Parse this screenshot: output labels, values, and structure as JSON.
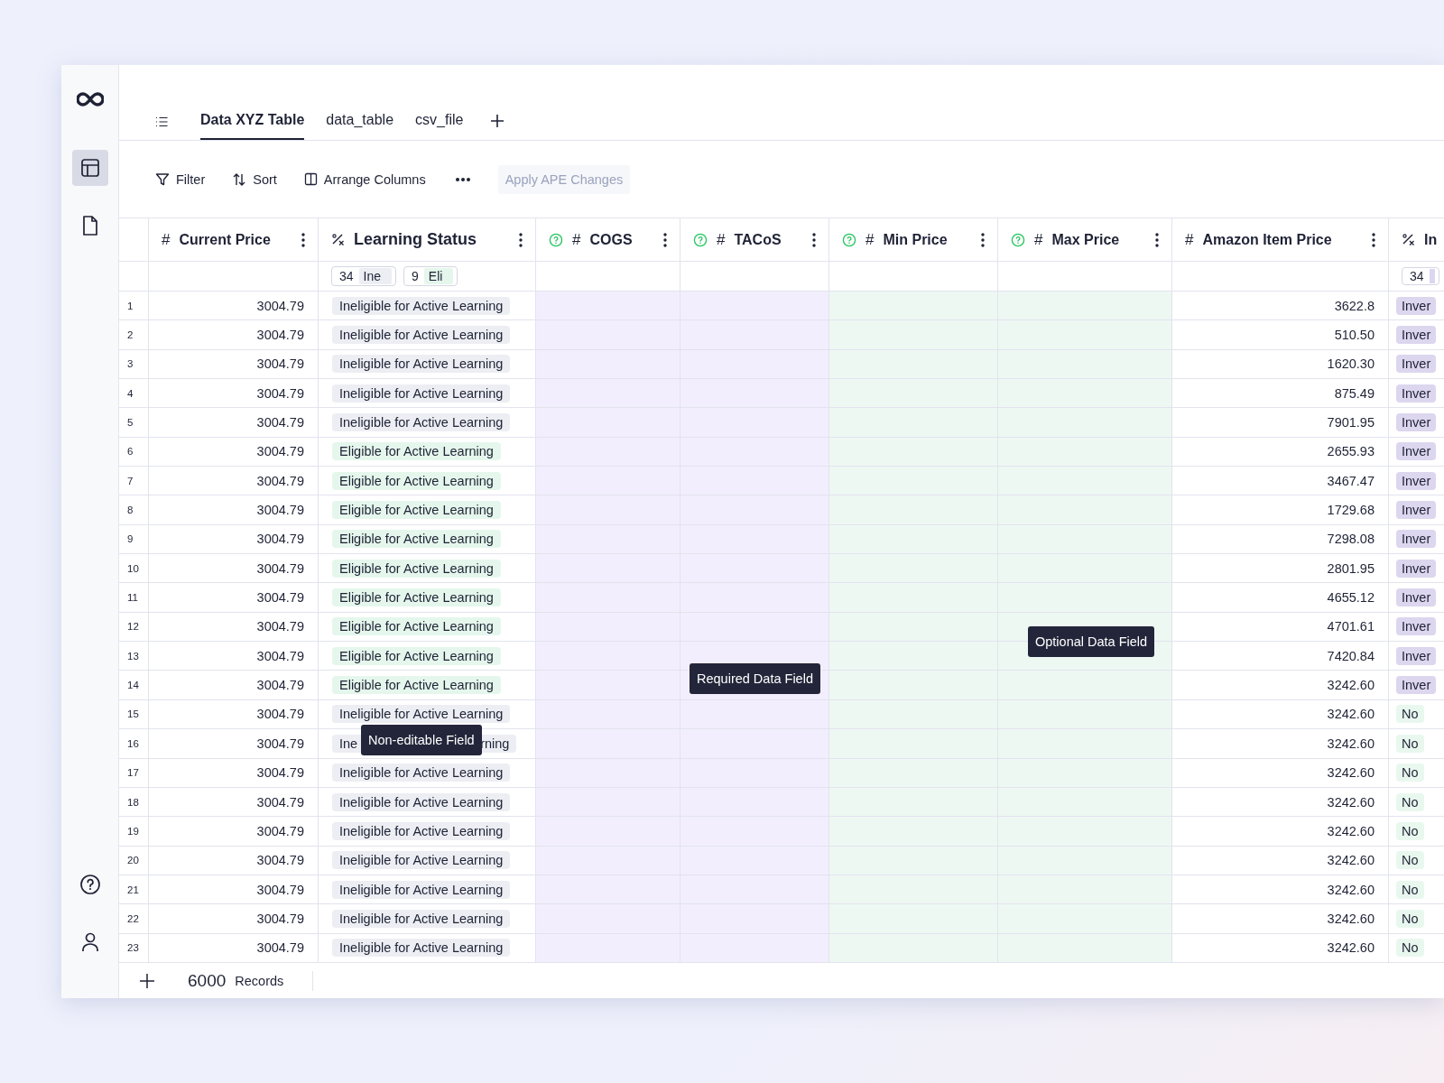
{
  "sidebar": {
    "items": [
      {
        "kind": "table",
        "selected": true
      },
      {
        "kind": "document",
        "selected": false
      }
    ]
  },
  "tabs": [
    {
      "label": "Data XYZ Table",
      "selected": true
    },
    {
      "label": "data_table",
      "selected": false
    },
    {
      "label": "csv_file",
      "selected": false
    }
  ],
  "toolbar": {
    "buttons": [
      {
        "kind": "filter",
        "label": "Filter"
      },
      {
        "kind": "sort",
        "label": "Sort"
      },
      {
        "kind": "columns",
        "label": "Arrange Columns"
      }
    ],
    "apply_button": {
      "label": "Apply APE Changes",
      "disabled": true
    }
  },
  "table": {
    "columns": [
      {
        "label": "Current Price",
        "symbol": "#",
        "kind": "plain",
        "menu": true
      },
      {
        "label": "Learning Status",
        "kind": "plain",
        "menu": true,
        "summary": [
          {
            "count": "34",
            "label": "Ine",
            "color": "#eceef3"
          },
          {
            "count": "9",
            "label": "Eli",
            "color": "#e5f7ec"
          }
        ]
      },
      {
        "label": "COGS",
        "symbol": "#",
        "kind": "required",
        "menu": true
      },
      {
        "label": "TACoS",
        "symbol": "#",
        "kind": "required",
        "menu": true
      },
      {
        "label": "Min Price",
        "symbol": "#",
        "kind": "optional",
        "menu": true
      },
      {
        "label": "Max Price",
        "symbol": "#",
        "kind": "optional",
        "menu": true
      },
      {
        "label": "Amazon Item Price",
        "symbol": "#",
        "kind": "plain",
        "menu": true
      },
      {
        "label": "In",
        "kind": "plain",
        "menu": false,
        "summary": [
          {
            "count": "34",
            "color": "#dcd6ee"
          }
        ]
      }
    ],
    "rows": [
      {
        "row_number": "1",
        "current_price": "3004.79",
        "learning_status": {
          "text": "Ineligible for Active Learning",
          "color": "#eceef3"
        },
        "amazon_item_price": "3622.8",
        "column_8": {
          "text": "Inver",
          "color": "#dcd6ee"
        }
      },
      {
        "row_number": "2",
        "current_price": "3004.79",
        "learning_status": {
          "text": "Ineligible for Active Learning",
          "color": "#eceef3"
        },
        "amazon_item_price": "510.50",
        "column_8": {
          "text": "Inver",
          "color": "#dcd6ee"
        }
      },
      {
        "row_number": "3",
        "current_price": "3004.79",
        "learning_status": {
          "text": "Ineligible for Active Learning",
          "color": "#eceef3"
        },
        "amazon_item_price": "1620.30",
        "column_8": {
          "text": "Inver",
          "color": "#dcd6ee"
        }
      },
      {
        "row_number": "4",
        "current_price": "3004.79",
        "learning_status": {
          "text": "Ineligible for Active Learning",
          "color": "#eceef3"
        },
        "amazon_item_price": "875.49",
        "column_8": {
          "text": "Inver",
          "color": "#dcd6ee"
        }
      },
      {
        "row_number": "5",
        "current_price": "3004.79",
        "learning_status": {
          "text": "Ineligible for Active Learning",
          "color": "#eceef3"
        },
        "amazon_item_price": "7901.95",
        "column_8": {
          "text": "Inver",
          "color": "#dcd6ee"
        }
      },
      {
        "row_number": "6",
        "current_price": "3004.79",
        "learning_status": {
          "text": "Eligible for Active Learning",
          "color": "#e5f7ec"
        },
        "amazon_item_price": "2655.93",
        "column_8": {
          "text": "Inver",
          "color": "#dcd6ee"
        }
      },
      {
        "row_number": "7",
        "current_price": "3004.79",
        "learning_status": {
          "text": "Eligible for Active Learning",
          "color": "#e5f7ec"
        },
        "amazon_item_price": "3467.47",
        "column_8": {
          "text": "Inver",
          "color": "#dcd6ee"
        }
      },
      {
        "row_number": "8",
        "current_price": "3004.79",
        "learning_status": {
          "text": "Eligible for Active Learning",
          "color": "#e5f7ec"
        },
        "amazon_item_price": "1729.68",
        "column_8": {
          "text": "Inver",
          "color": "#dcd6ee"
        }
      },
      {
        "row_number": "9",
        "current_price": "3004.79",
        "learning_status": {
          "text": "Eligible for Active Learning",
          "color": "#e5f7ec"
        },
        "amazon_item_price": "7298.08",
        "column_8": {
          "text": "Inver",
          "color": "#dcd6ee"
        }
      },
      {
        "row_number": "10",
        "current_price": "3004.79",
        "learning_status": {
          "text": "Eligible for Active Learning",
          "color": "#e5f7ec"
        },
        "amazon_item_price": "2801.95",
        "column_8": {
          "text": "Inver",
          "color": "#dcd6ee"
        }
      },
      {
        "row_number": "11",
        "current_price": "3004.79",
        "learning_status": {
          "text": "Eligible for Active Learning",
          "color": "#e5f7ec"
        },
        "amazon_item_price": "4655.12",
        "column_8": {
          "text": "Inver",
          "color": "#dcd6ee"
        }
      },
      {
        "row_number": "12",
        "current_price": "3004.79",
        "learning_status": {
          "text": "Eligible for Active Learning",
          "color": "#e5f7ec"
        },
        "amazon_item_price": "4701.61",
        "column_8": {
          "text": "Inver",
          "color": "#dcd6ee"
        }
      },
      {
        "row_number": "13",
        "current_price": "3004.79",
        "learning_status": {
          "text": "Eligible for Active Learning",
          "color": "#e5f7ec"
        },
        "amazon_item_price": "7420.84",
        "column_8": {
          "text": "Inver",
          "color": "#dcd6ee"
        }
      },
      {
        "row_number": "14",
        "current_price": "3004.79",
        "learning_status": {
          "text": "Eligible for Active Learning",
          "color": "#e5f7ec"
        },
        "amazon_item_price": "3242.60",
        "column_8": {
          "text": "Inver",
          "color": "#dcd6ee"
        }
      },
      {
        "row_number": "15",
        "current_price": "3004.79",
        "learning_status": {
          "text": "Ineligible for Active Learning",
          "color": "#eceef3"
        },
        "amazon_item_price": "3242.60",
        "column_8": {
          "text": "No",
          "color": "#e9f8ef"
        }
      },
      {
        "row_number": "16",
        "current_price": "3004.79",
        "learning_status": {
          "text": "Ine",
          "text_end": "rning",
          "color": "#eceef3"
        },
        "amazon_item_price": "3242.60",
        "column_8": {
          "text": "No",
          "color": "#e9f8ef"
        }
      },
      {
        "row_number": "17",
        "current_price": "3004.79",
        "learning_status": {
          "text": "Ineligible for Active Learning",
          "color": "#eceef3"
        },
        "amazon_item_price": "3242.60",
        "column_8": {
          "text": "No",
          "color": "#e9f8ef"
        }
      },
      {
        "row_number": "18",
        "current_price": "3004.79",
        "learning_status": {
          "text": "Ineligible for Active Learning",
          "color": "#eceef3"
        },
        "amazon_item_price": "3242.60",
        "column_8": {
          "text": "No",
          "color": "#e9f8ef"
        }
      },
      {
        "row_number": "19",
        "current_price": "3004.79",
        "learning_status": {
          "text": "Ineligible for Active Learning",
          "color": "#eceef3"
        },
        "amazon_item_price": "3242.60",
        "column_8": {
          "text": "No",
          "color": "#e9f8ef"
        }
      },
      {
        "row_number": "20",
        "current_price": "3004.79",
        "learning_status": {
          "text": "Ineligible for Active Learning",
          "color": "#eceef3"
        },
        "amazon_item_price": "3242.60",
        "column_8": {
          "text": "No",
          "color": "#e9f8ef"
        }
      },
      {
        "row_number": "21",
        "current_price": "3004.79",
        "learning_status": {
          "text": "Ineligible for Active Learning",
          "color": "#eceef3"
        },
        "amazon_item_price": "3242.60",
        "column_8": {
          "text": "No",
          "color": "#e9f8ef"
        }
      },
      {
        "row_number": "22",
        "current_price": "3004.79",
        "learning_status": {
          "text": "Ineligible for Active Learning",
          "color": "#eceef3"
        },
        "amazon_item_price": "3242.60",
        "column_8": {
          "text": "No",
          "color": "#e9f8ef"
        }
      },
      {
        "row_number": "23",
        "current_price": "3004.79",
        "learning_status": {
          "text": "Ineligible for Active Learning",
          "color": "#eceef3"
        },
        "amazon_item_price": "3242.60",
        "column_8": {
          "text": "No",
          "color": "#e9f8ef"
        }
      }
    ]
  },
  "tooltips": [
    "Non-editable Field",
    "Required Data Field",
    "Optional Data Field"
  ],
  "footer": {
    "count": "6000",
    "label": "Records"
  }
}
